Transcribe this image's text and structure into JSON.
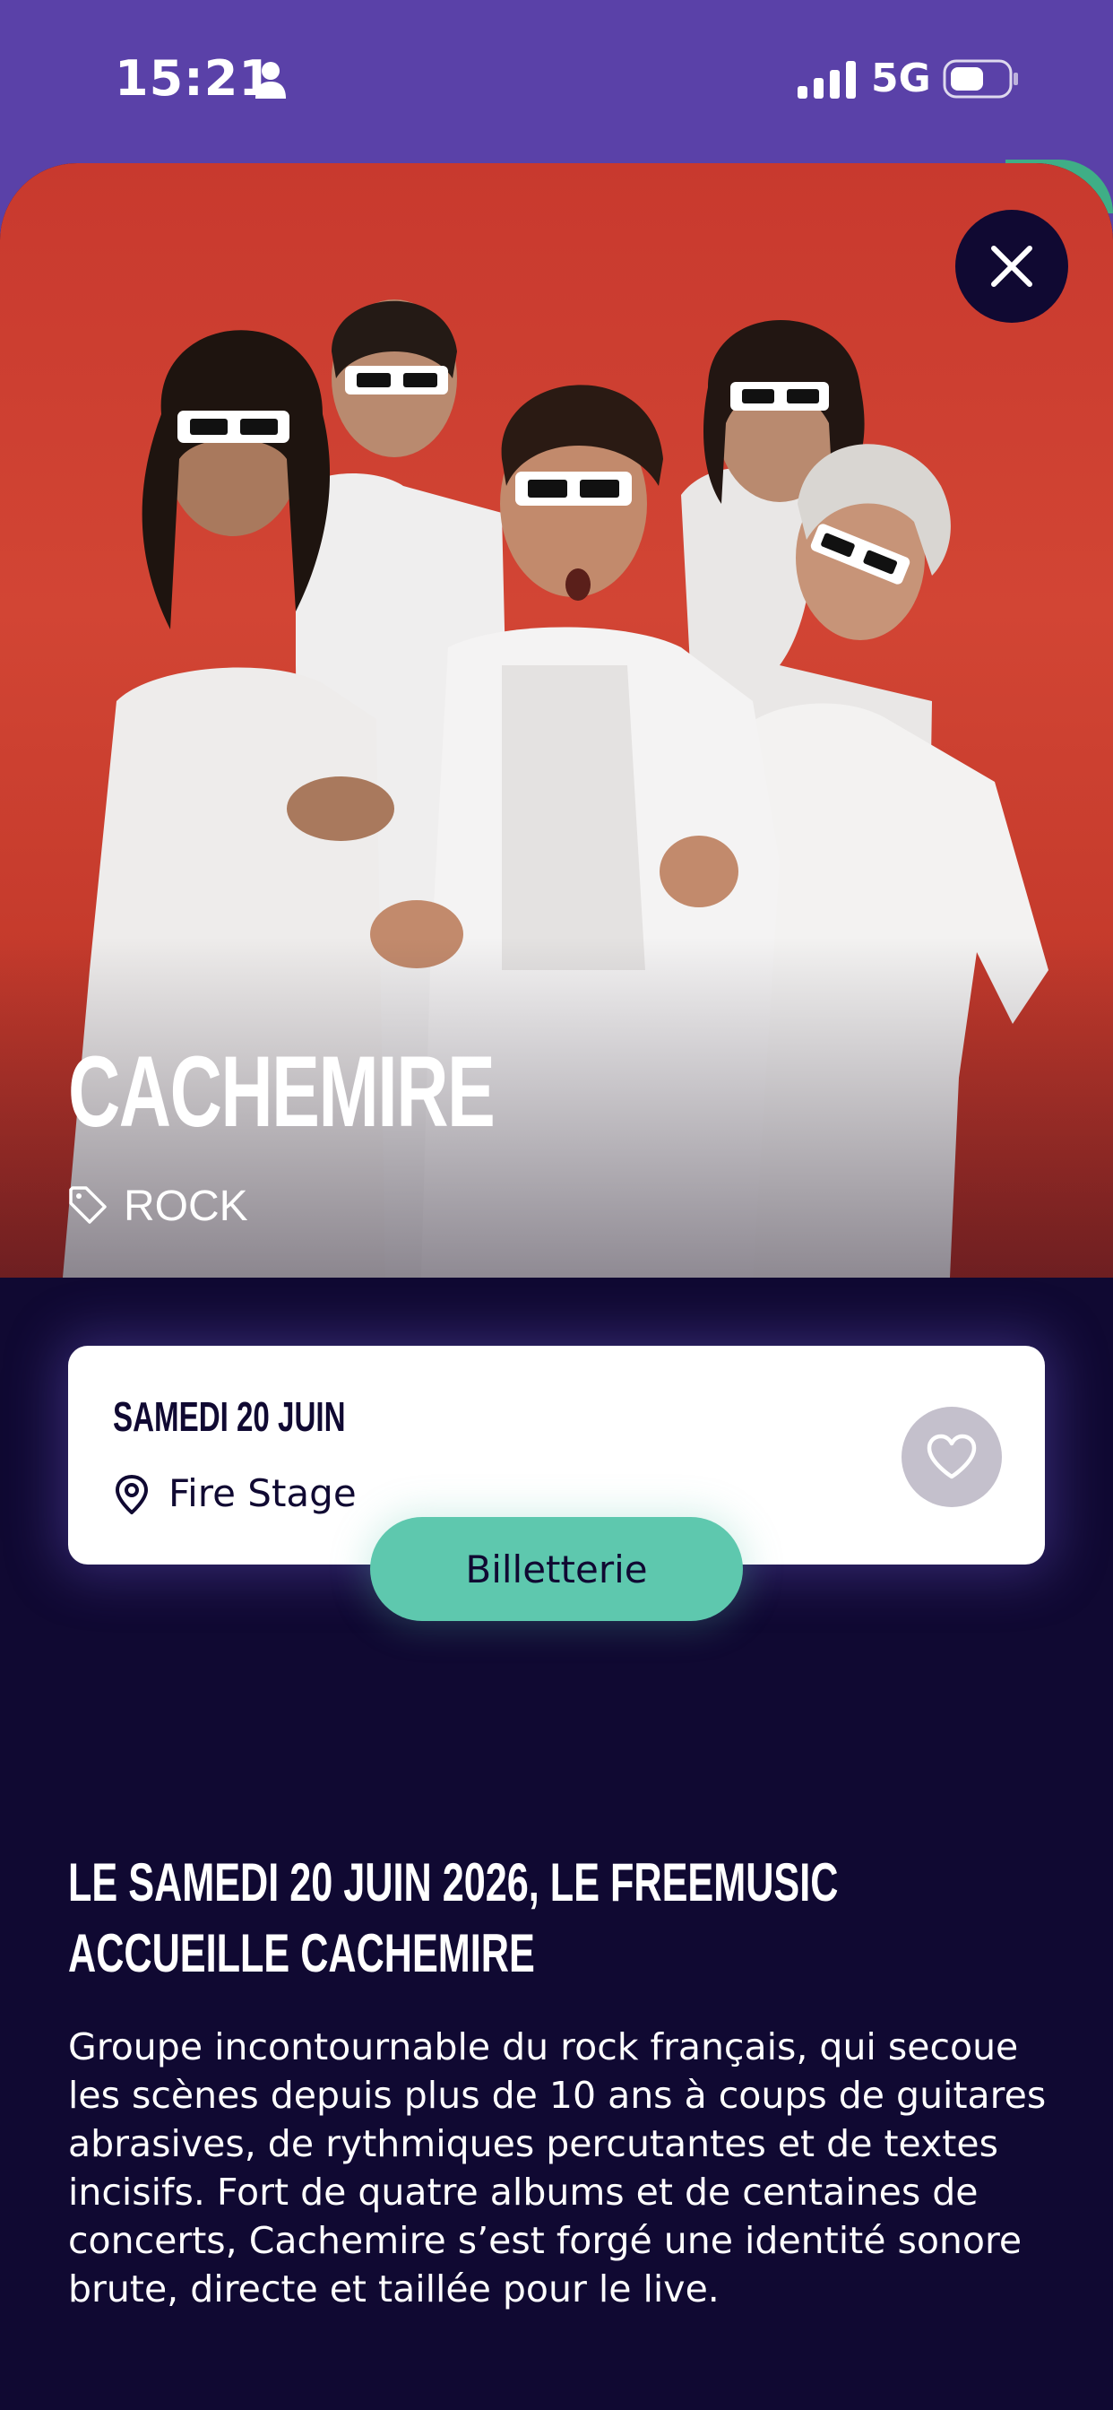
{
  "status_bar": {
    "time": "15:21",
    "network": "5G",
    "icons": [
      "person-icon",
      "signal-icon",
      "battery-icon"
    ]
  },
  "artist": {
    "name": "CACHEMIRE",
    "genre": "ROCK",
    "photo": "band-photo"
  },
  "event": {
    "date": "SAMEDI 20 JUIN",
    "stage": "Fire Stage"
  },
  "actions": {
    "ticket_label": "Billetterie"
  },
  "article": {
    "headline": "LE SAMEDI 20 JUIN 2026, LE FREEMUSIC ACCUEILLE CACHEMIRE",
    "description": "Groupe incontournable du rock français, qui secoue les scènes depuis plus de 10 ans à coups de guitares abrasives, de rythmiques percutantes et de textes incisifs. Fort de quatre albums et de centaines de concerts, Cachemire s’est forgé une identité sonore brute, directe et taillée pour le live."
  },
  "colors": {
    "status_bar": "#5a41a8",
    "background": "#100932",
    "hero_backdrop": "#c8392e",
    "ticket_button": "#5ec8ae",
    "favorite_button": "#c4c0cc"
  }
}
